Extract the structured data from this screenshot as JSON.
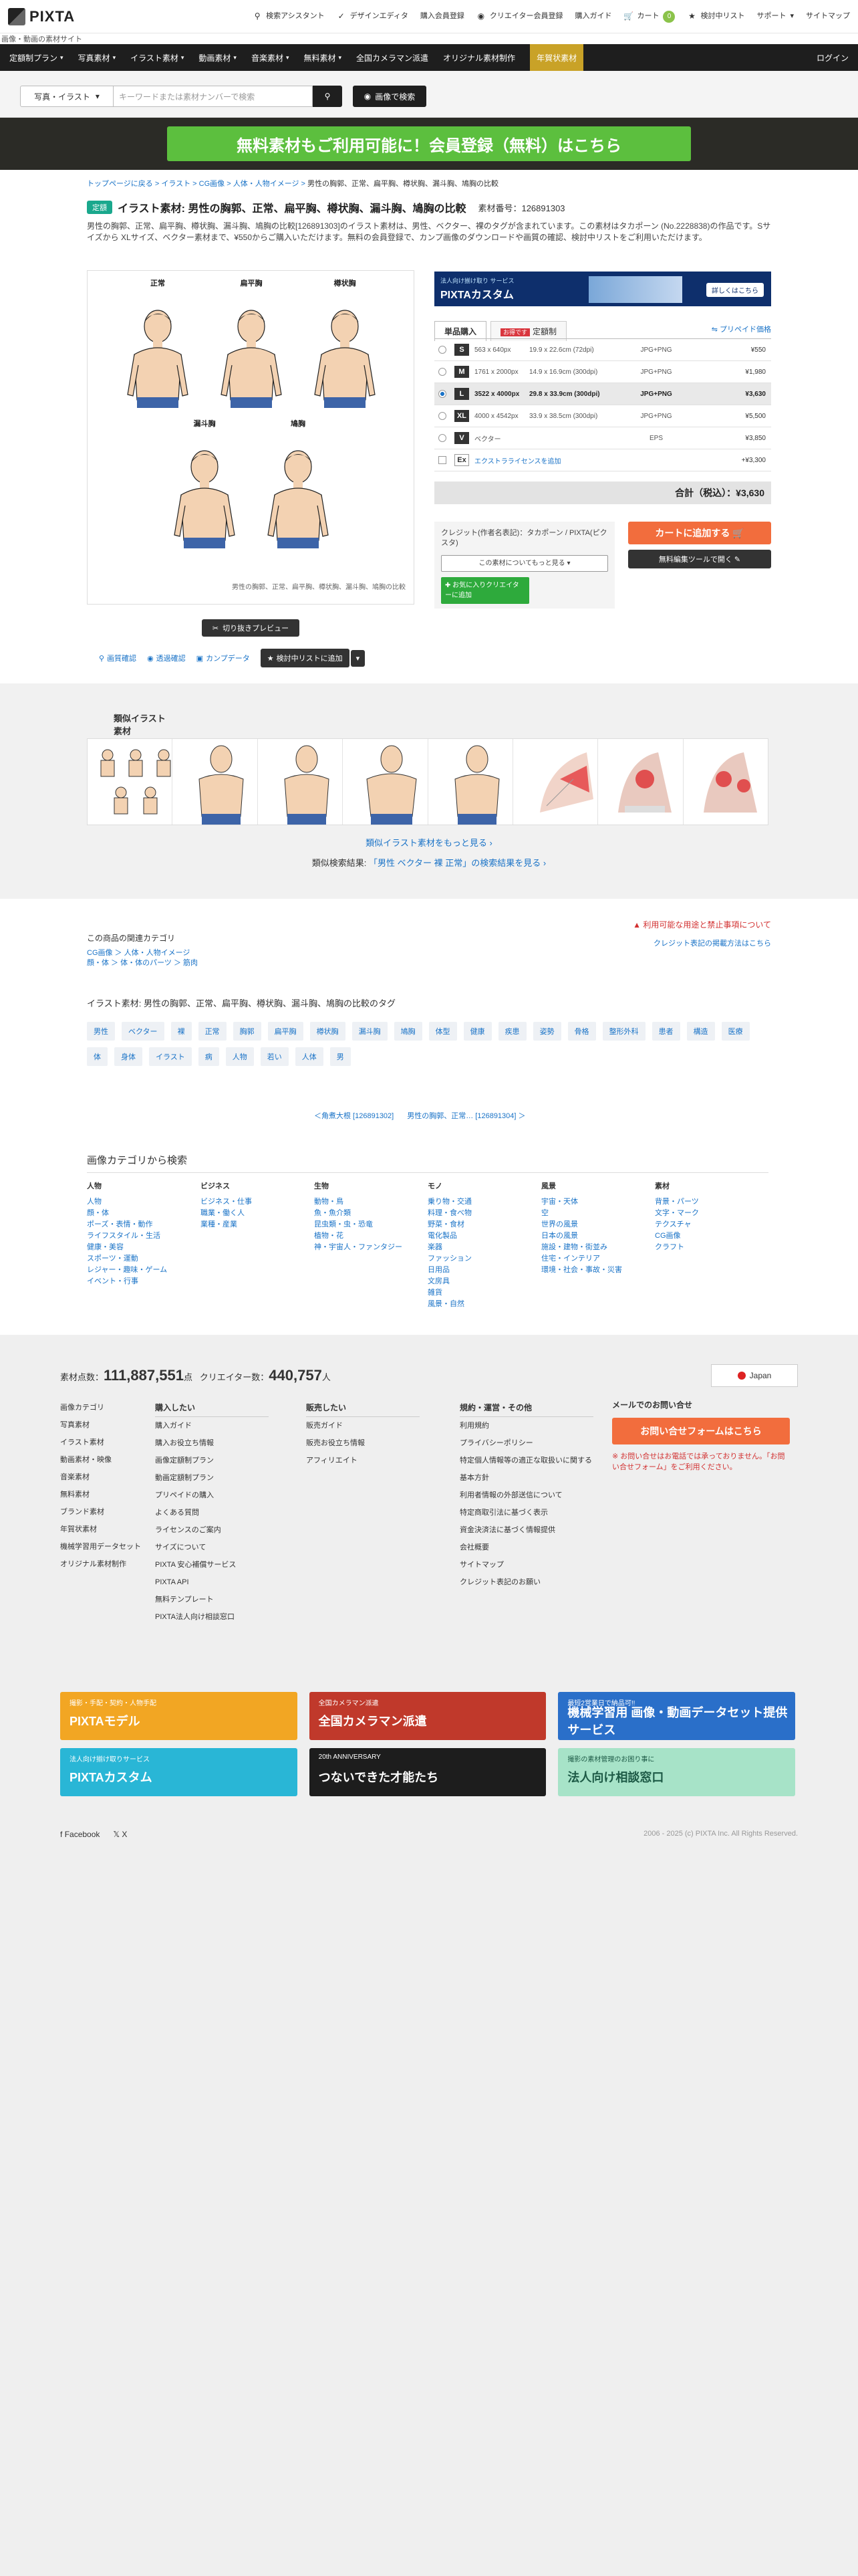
{
  "header": {
    "logo": "PIXTA",
    "tagline": "画像・動画の素材サイト",
    "nav": [
      {
        "icon": "search-icon",
        "label": "検索アシスタント"
      },
      {
        "icon": "design-editor-icon",
        "label": "デザインエディタ"
      },
      {
        "icon": "",
        "label": "購入会員登録"
      },
      {
        "icon": "camera-icon",
        "label": "クリエイター会員登録"
      },
      {
        "icon": "",
        "label": "購入ガイド"
      },
      {
        "icon": "cart-icon",
        "label": "カート",
        "badge": "0"
      },
      {
        "icon": "star-icon",
        "label": "検討中リスト"
      },
      {
        "icon": "",
        "label": "サポート"
      },
      {
        "icon": "",
        "label": "サイトマップ"
      }
    ]
  },
  "menu": {
    "items": [
      "定額制プラン",
      "写真素材",
      "イラスト素材",
      "動画素材",
      "音楽素材",
      "無料素材",
      "全国カメラマン派遣",
      "オリジナル素材制作",
      "年賀状素材"
    ],
    "login": "ログイン"
  },
  "search": {
    "type": "写真・イラスト",
    "placeholder": "キーワードまたは素材ナンバーで検索",
    "image_search": "画像で検索"
  },
  "banner": {
    "text": "無料素材もご利用可能に！会員登録（無料）はこちら"
  },
  "breadcrumb": {
    "links": [
      "トップページに戻る",
      "イラスト",
      "CG画像",
      "人体・人物イメージ"
    ],
    "current": "男性の胸郭、正常、扁平胸、樽状胸、漏斗胸、鳩胸の比較"
  },
  "product": {
    "badge": "定額",
    "title": "イラスト素材: 男性の胸郭、正常、扁平胸、樽状胸、漏斗胸、鳩胸の比較",
    "number_label": "素材番号：126891303",
    "description": "男性の胸郭、正常、扁平胸、樽状胸、漏斗胸、鳩胸の比較[126891303]のイラスト素材は、男性、ベクター、裸のタグが含まれています。この素材はタカポーン (No.2228838)の作品です。Sサイズから XLサイズ、ベクター素材まで、¥550からご購入いただけます。無料の会員登録で、カンプ画像のダウンロードや画質の確認、検討中リストをご利用いただけます。",
    "figures": [
      "正常",
      "扁平胸",
      "樽状胸",
      "漏斗胸",
      "鳩胸"
    ],
    "preview_caption": "男性の胸郭、正常、扁平胸、樽状胸、漏斗胸、鳩胸の比較",
    "crop_button": "切り抜きプレビュー",
    "actions": [
      "画質確認",
      "透過確認",
      "カンプデータ"
    ],
    "wishlist_button": "検討中リストに追加"
  },
  "ad_box": {
    "small": "法人向け揃け取り サービス",
    "title": "PIXTAカスタム",
    "button": "詳しくはこちら"
  },
  "purchase": {
    "tabs": [
      {
        "label": "単品購入",
        "active": true
      },
      {
        "label": "定額制",
        "tag": "お得です",
        "active": false
      }
    ],
    "plan_link": "プリペイド価格",
    "rows": [
      {
        "size": "S",
        "px": "563 x 640px",
        "cm": "19.9 x 22.6cm (72dpi)",
        "fmt": "JPG+PNG",
        "price": "¥550",
        "selected": false
      },
      {
        "size": "M",
        "px": "1761 x 2000px",
        "cm": "14.9 x 16.9cm (300dpi)",
        "fmt": "JPG+PNG",
        "price": "¥1,980",
        "selected": false
      },
      {
        "size": "L",
        "px": "3522 x 4000px",
        "cm": "29.8 x 33.9cm (300dpi)",
        "fmt": "JPG+PNG",
        "price": "¥3,630",
        "selected": true
      },
      {
        "size": "XL",
        "px": "4000 x 4542px",
        "cm": "33.9 x 38.5cm (300dpi)",
        "fmt": "JPG+PNG",
        "price": "¥5,500",
        "selected": false
      },
      {
        "size": "V",
        "px": "ベクター",
        "cm": "",
        "fmt": "EPS",
        "price": "¥3,850",
        "selected": false
      }
    ],
    "extra": {
      "size": "Ex",
      "label": "エクストラライセンスを追加",
      "price": "+¥3,300"
    },
    "total": "合計（税込）：¥3,630",
    "credit_text": "クレジット(作者名表記)：タカポーン / PIXTA(ピクスタ)",
    "credit_author": "タカポーン",
    "about_button": "この素材についてもっと見る",
    "follow_button": "お気に入りクリエイターに追加",
    "cart_button": "カートに追加する",
    "edit_button": "無料編集ツールで開く"
  },
  "similar": {
    "heading": "類似イラスト素材",
    "more_link": "類似イラスト素材をもっと見る",
    "result_text": "類似検索結果:",
    "result_link": "「男性 ベクター 裸 正常」の検索結果を見る"
  },
  "related": {
    "category_heading": "この商品の関連カテゴリ",
    "category_links": [
      "CG画像 ＞ 人体・人物イメージ",
      "顔・体 ＞ 体・体のパーツ ＞ 筋肉"
    ],
    "warning": "利用可能な用途と禁止事項について",
    "credit_link": "クレジット表記の掲載方法はこちら",
    "tag_heading": "イラスト素材: 男性の胸郭、正常、扁平胸、樽状胸、漏斗胸、鳩胸の比較のタグ",
    "tags": [
      "男性",
      "ベクター",
      "裸",
      "正常",
      "胸郭",
      "扁平胸",
      "樽状胸",
      "漏斗胸",
      "鳩胸",
      "体型",
      "健康",
      "疾患",
      "姿勢",
      "骨格",
      "整形外科",
      "患者",
      "構造",
      "医療",
      "体",
      "身体",
      "イラスト",
      "病",
      "人物",
      "若い",
      "人体",
      "男"
    ],
    "prev": "＜角煮大根 [126891302]",
    "next": "男性の胸郭、正常… [126891304] ＞"
  },
  "categories": {
    "heading": "画像カテゴリから検索",
    "cols": [
      {
        "hd": "人物",
        "links": [
          "人物",
          "顔・体",
          "ポーズ・表情・動作",
          "ライフスタイル・生活",
          "健康・美容",
          "スポーツ・運動",
          "レジャー・趣味・ゲーム",
          "イベント・行事"
        ]
      },
      {
        "hd": "ビジネス",
        "links": [
          "ビジネス・仕事",
          "職業・働く人",
          "業種・産業"
        ]
      },
      {
        "hd": "生物",
        "links": [
          "動物・鳥",
          "魚・魚介類",
          "昆虫類・虫・恐竜",
          "植物・花",
          "神・宇宙人・ファンタジー"
        ]
      },
      {
        "hd": "モノ",
        "links": [
          "乗り物・交通",
          "料理・食べ物",
          "野菜・食材",
          "電化製品",
          "楽器",
          "ファッション",
          "日用品",
          "文房具",
          "雑貨",
          "風景・自然"
        ]
      },
      {
        "hd": "風景",
        "links": [
          "宇宙・天体",
          "空",
          "世界の風景",
          "日本の風景",
          "施設・建物・街並み",
          "住宅・インテリア",
          "環境・社会・事故・災害"
        ]
      },
      {
        "hd": "素材",
        "links": [
          "背景・パーツ",
          "文字・マーク",
          "テクスチャ",
          "CG画像",
          "クラフト"
        ]
      }
    ]
  },
  "footer": {
    "stats_label1": "素材点数：",
    "stats_value1": "111,887,551",
    "stats_unit1": "点",
    "stats_label2": "クリエイター数：",
    "stats_value2": "440,757",
    "stats_unit2": "人",
    "lang": "Japan",
    "col1": [
      "画像カテゴリ",
      "写真素材",
      "イラスト素材",
      "動画素材・映像",
      "音楽素材",
      "無料素材",
      "ブランド素材",
      "年賀状素材",
      "機械学習用データセット",
      "オリジナル素材制作"
    ],
    "col2hd": "購入したい",
    "col2": [
      "購入ガイド",
      "購入お役立ち情報",
      "画像定額制プラン",
      "動画定額制プラン",
      "プリペイドの購入",
      "よくある質問",
      "ライセンスのご案内",
      "サイズについて",
      "PIXTA 安心補償サービス",
      "PIXTA API",
      "無料テンプレート",
      "PIXTA法人向け相談窓口"
    ],
    "col3hd": "販売したい",
    "col3": [
      "販売ガイド",
      "販売お役立ち情報",
      "アフィリエイト"
    ],
    "col4hd": "規約・運営・その他",
    "col4": [
      "利用規約",
      "プライバシーポリシー",
      "特定個人情報等の適正な取扱いに関する基本方針",
      "利用者情報の外部送信について",
      "特定商取引法に基づく表示",
      "資金決済法に基づく情報提供",
      "会社概要",
      "サイトマップ",
      "クレジット表記のお願い"
    ],
    "mail_heading": "メールでのお問い合せ",
    "mail_button": "お問い合せフォームはこちら",
    "mail_note": "※ お問い合せはお電話では承っておりません。「お問い合せフォーム」をご利用ください。",
    "ads": [
      {
        "sm": "撮影・手配・契約・人物手配",
        "title": "PIXTAモデル",
        "color": "#f2a623"
      },
      {
        "sm": "全国カメラマン派遣",
        "title": "全国カメラマン派遣",
        "color": "#c0392b"
      },
      {
        "sm": "最短2営業日で納品可!!",
        "title": "機械学習用 画像・動画データセット提供サービス",
        "color": "#2a6fc9"
      },
      {
        "sm": "法人向け揃け取りサービス",
        "title": "PIXTAカスタム",
        "color": "#29b6d6"
      },
      {
        "sm": "20th ANNIVERSARY",
        "title": "つないできた才能たち",
        "color": "#1d1d1d"
      },
      {
        "sm": "撮影の素材管理のお困り事に",
        "title": "法人向け相談窓口",
        "color": "#a7e3c8"
      }
    ],
    "social": [
      "Facebook",
      "X"
    ],
    "copyright": "2006 - 2025 (c) PIXTA Inc. All Rights Reserved."
  }
}
